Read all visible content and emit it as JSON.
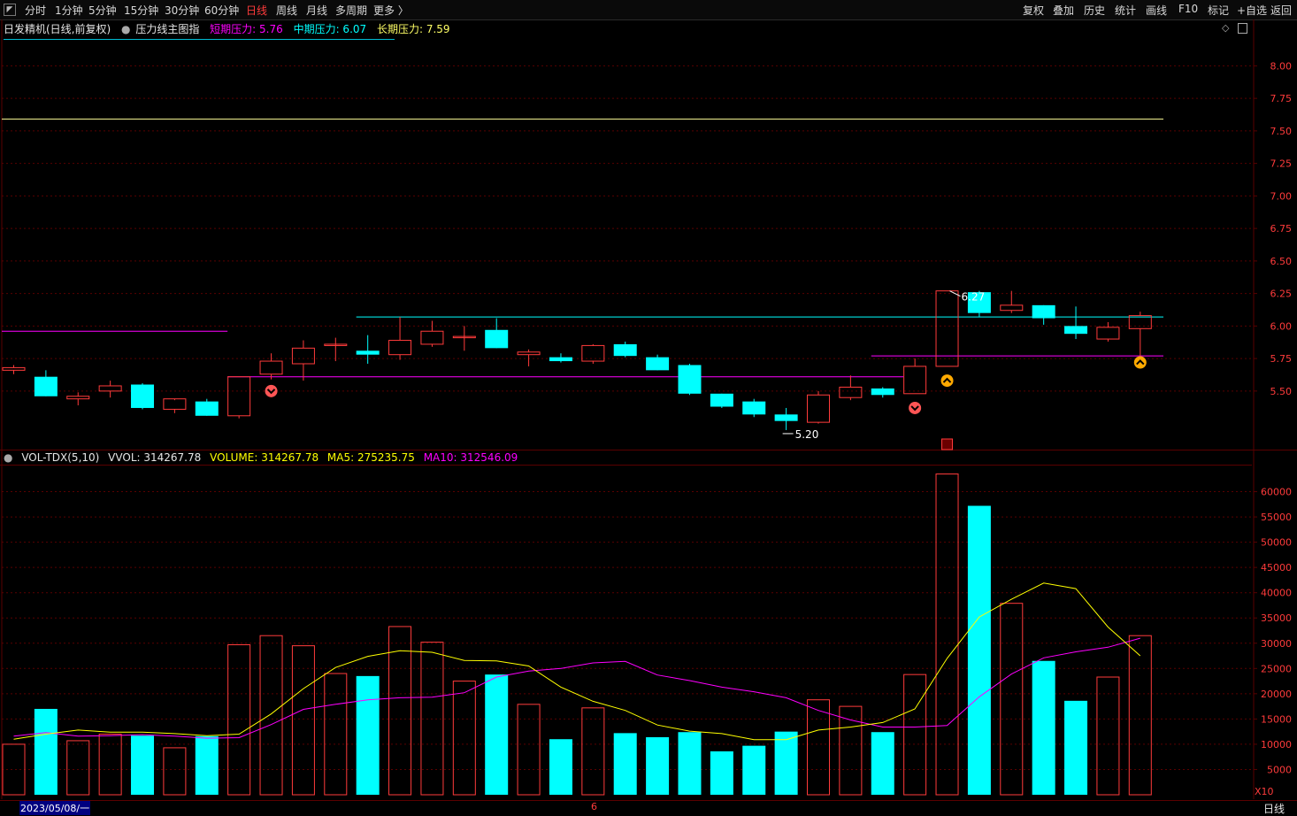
{
  "toolbar": {
    "periods": [
      "分时",
      "1分钟",
      "5分钟",
      "15分钟",
      "30分钟",
      "60分钟",
      "日线",
      "周线",
      "月线",
      "多周期",
      "更多 〉"
    ],
    "active_period": "日线",
    "right_buttons": [
      "复权",
      "叠加",
      "历史",
      "统计",
      "画线",
      "F10",
      "标记",
      "+自选",
      "返回"
    ]
  },
  "main_legend": {
    "title": "日发精机(日线,前复权)",
    "indicator": "压力线主图指",
    "short_label": "短期压力: 5.76",
    "mid_label": "中期压力: 6.07",
    "long_label": "长期压力: 7.59"
  },
  "vol_legend": {
    "name": "VOL-TDX(5,10)",
    "vvol": "VVOL: 314267.78",
    "volume": "VOLUME: 314267.78",
    "ma5": "MA5: 275235.75",
    "ma10": "MA10: 312546.09"
  },
  "status": {
    "date": "2023/05/08/一",
    "month_mark": "6",
    "period_label": "日线",
    "x10_label": "X10"
  },
  "colors": {
    "up": "#ff3b3b",
    "down": "#00ffff",
    "ma5": "#ffff00",
    "ma10": "#ff00ff",
    "short": "#ff00ff",
    "mid": "#00ffff",
    "long": "#ffff99",
    "grid": "#5a0000",
    "axis_text": "#ff3b3b"
  },
  "chart_data": {
    "type": "candlestick",
    "price_ticks": [
      8.0,
      7.75,
      7.5,
      7.25,
      7.0,
      6.75,
      6.5,
      6.25,
      6.0,
      5.75,
      5.5
    ],
    "price_range": [
      5.05,
      8.2
    ],
    "volume_ticks": [
      60000,
      55000,
      50000,
      45000,
      40000,
      35000,
      30000,
      25000,
      20000,
      15000,
      10000,
      5000
    ],
    "volume_range": [
      0,
      65000
    ],
    "high_label": "6.27",
    "low_label": "5.20",
    "long_pressure": 7.59,
    "short_pressure_segments": [
      {
        "from": 0,
        "to": 7,
        "value": 5.96
      },
      {
        "from": 7,
        "to": 28,
        "value": 5.61
      },
      {
        "from": 27,
        "to": 36,
        "value": 5.77
      }
    ],
    "mid_pressure_segments": [
      {
        "from": 11,
        "to": 36,
        "value": 6.07
      }
    ],
    "candles": [
      {
        "o": 5.66,
        "h": 5.7,
        "l": 5.63,
        "c": 5.68,
        "v": 10000
      },
      {
        "o": 5.61,
        "h": 5.66,
        "l": 5.46,
        "c": 5.46,
        "v": 17000
      },
      {
        "o": 5.44,
        "h": 5.49,
        "l": 5.39,
        "c": 5.46,
        "v": 10700
      },
      {
        "o": 5.5,
        "h": 5.58,
        "l": 5.45,
        "c": 5.54,
        "v": 12000
      },
      {
        "o": 5.55,
        "h": 5.56,
        "l": 5.36,
        "c": 5.37,
        "v": 11700
      },
      {
        "o": 5.36,
        "h": 5.43,
        "l": 5.33,
        "c": 5.44,
        "v": 9300
      },
      {
        "o": 5.42,
        "h": 5.44,
        "l": 5.31,
        "c": 5.31,
        "v": 11600
      },
      {
        "o": 5.31,
        "h": 5.61,
        "l": 5.29,
        "c": 5.61,
        "v": 29700
      },
      {
        "o": 5.63,
        "h": 5.79,
        "l": 5.59,
        "c": 5.73,
        "v": 31500
      },
      {
        "o": 5.71,
        "h": 5.89,
        "l": 5.58,
        "c": 5.83,
        "v": 29500
      },
      {
        "o": 5.86,
        "h": 5.91,
        "l": 5.73,
        "c": 5.86,
        "v": 24000
      },
      {
        "o": 5.81,
        "h": 5.93,
        "l": 5.71,
        "c": 5.78,
        "v": 23500
      },
      {
        "o": 5.78,
        "h": 6.07,
        "l": 5.74,
        "c": 5.89,
        "v": 33300
      },
      {
        "o": 5.86,
        "h": 6.04,
        "l": 5.84,
        "c": 5.96,
        "v": 30200
      },
      {
        "o": 5.92,
        "h": 6.0,
        "l": 5.81,
        "c": 5.92,
        "v": 22500
      },
      {
        "o": 5.97,
        "h": 6.06,
        "l": 5.83,
        "c": 5.83,
        "v": 23800
      },
      {
        "o": 5.78,
        "h": 5.82,
        "l": 5.69,
        "c": 5.8,
        "v": 17900
      },
      {
        "o": 5.76,
        "h": 5.79,
        "l": 5.72,
        "c": 5.73,
        "v": 11000
      },
      {
        "o": 5.73,
        "h": 5.86,
        "l": 5.71,
        "c": 5.85,
        "v": 17200
      },
      {
        "o": 5.86,
        "h": 5.88,
        "l": 5.76,
        "c": 5.77,
        "v": 12200
      },
      {
        "o": 5.76,
        "h": 5.78,
        "l": 5.66,
        "c": 5.66,
        "v": 11400
      },
      {
        "o": 5.7,
        "h": 5.71,
        "l": 5.47,
        "c": 5.48,
        "v": 12400
      },
      {
        "o": 5.48,
        "h": 5.48,
        "l": 5.37,
        "c": 5.38,
        "v": 8600
      },
      {
        "o": 5.42,
        "h": 5.44,
        "l": 5.3,
        "c": 5.32,
        "v": 9700
      },
      {
        "o": 5.32,
        "h": 5.37,
        "l": 5.2,
        "c": 5.27,
        "v": 12500
      },
      {
        "o": 5.26,
        "h": 5.5,
        "l": 5.25,
        "c": 5.47,
        "v": 18800
      },
      {
        "o": 5.45,
        "h": 5.62,
        "l": 5.43,
        "c": 5.53,
        "v": 17500
      },
      {
        "o": 5.52,
        "h": 5.53,
        "l": 5.45,
        "c": 5.47,
        "v": 12400
      },
      {
        "o": 5.48,
        "h": 5.75,
        "l": 5.48,
        "c": 5.69,
        "v": 23800
      },
      {
        "o": 5.69,
        "h": 6.27,
        "l": 5.69,
        "c": 6.27,
        "v": 63500
      },
      {
        "o": 6.26,
        "h": 6.27,
        "l": 6.07,
        "c": 6.1,
        "v": 57200
      },
      {
        "o": 6.12,
        "h": 6.27,
        "l": 6.1,
        "c": 6.16,
        "v": 37900
      },
      {
        "o": 6.16,
        "h": 6.16,
        "l": 6.01,
        "c": 6.06,
        "v": 26500
      },
      {
        "o": 6.0,
        "h": 6.15,
        "l": 5.9,
        "c": 5.94,
        "v": 18600
      },
      {
        "o": 5.9,
        "h": 6.03,
        "l": 5.88,
        "c": 5.99,
        "v": 23300
      },
      {
        "o": 5.98,
        "h": 6.11,
        "l": 5.76,
        "c": 6.08,
        "v": 31500
      }
    ],
    "ma5": [
      11000,
      12000,
      12800,
      12400,
      12400,
      12100,
      11700,
      12000,
      16000,
      21000,
      25200,
      27400,
      28500,
      28200,
      26600,
      26500,
      25500,
      21300,
      18500,
      16700,
      13800,
      12600,
      12100,
      10900,
      10900,
      12800,
      13400,
      14300,
      17000,
      27000,
      35200,
      38700,
      41900,
      40800,
      33200,
      27500
    ],
    "ma10": [
      11600,
      12300,
      11600,
      11700,
      11900,
      11600,
      11200,
      11300,
      13900,
      16900,
      17900,
      18800,
      19200,
      19300,
      20200,
      23300,
      24500,
      25000,
      26100,
      26400,
      23700,
      22600,
      21300,
      20400,
      19200,
      16700,
      14800,
      13400,
      13400,
      13700,
      19400,
      23900,
      27100,
      28300,
      29200,
      31000
    ]
  }
}
